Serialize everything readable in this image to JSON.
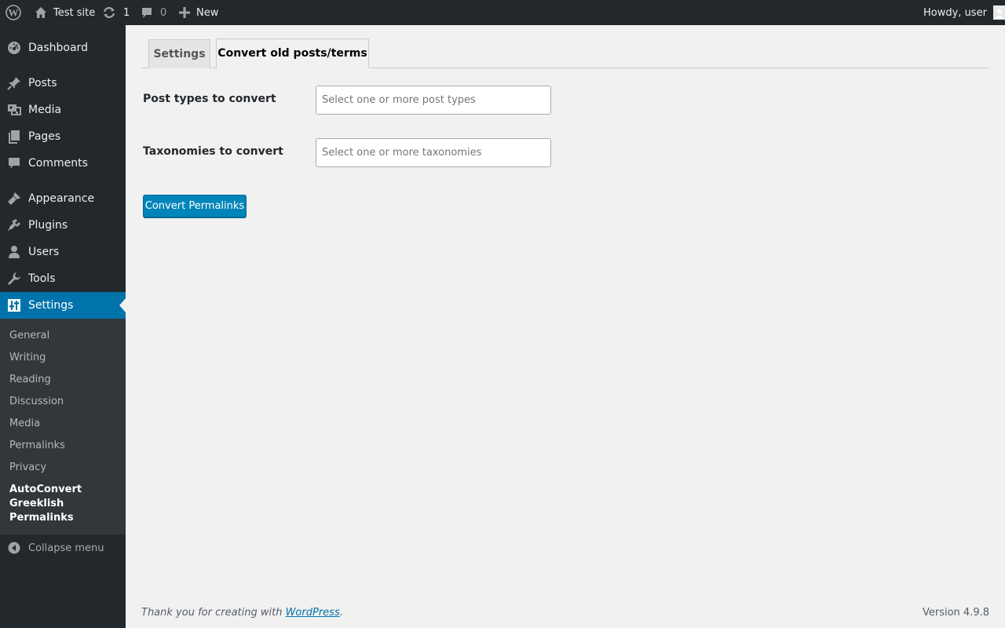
{
  "adminbar": {
    "site_name": "Test site",
    "updates_count": "1",
    "comments_count": "0",
    "new_label": "New",
    "greeting": "Howdy, user"
  },
  "menu": {
    "items": [
      {
        "label": "Dashboard",
        "icon": "dashboard-icon"
      },
      {
        "label": "Posts",
        "icon": "pin-icon"
      },
      {
        "label": "Media",
        "icon": "media-icon"
      },
      {
        "label": "Pages",
        "icon": "pages-icon"
      },
      {
        "label": "Comments",
        "icon": "comment-icon"
      },
      {
        "label": "Appearance",
        "icon": "brush-icon"
      },
      {
        "label": "Plugins",
        "icon": "plugin-icon"
      },
      {
        "label": "Users",
        "icon": "user-icon"
      },
      {
        "label": "Tools",
        "icon": "wrench-icon"
      },
      {
        "label": "Settings",
        "icon": "settings-icon"
      }
    ],
    "submenu": [
      "General",
      "Writing",
      "Reading",
      "Discussion",
      "Media",
      "Permalinks",
      "Privacy",
      "AutoConvert Greeklish Permalinks"
    ],
    "collapse_label": "Collapse menu"
  },
  "tabs": {
    "settings": "Settings",
    "convert": "Convert old posts/terms"
  },
  "form": {
    "post_types_label": "Post types to convert",
    "post_types_placeholder": "Select one or more post types",
    "taxonomies_label": "Taxonomies to convert",
    "taxonomies_placeholder": "Select one or more taxonomies",
    "submit_label": "Convert Permalinks"
  },
  "footer": {
    "thanks_prefix": "Thank you for creating with ",
    "thanks_link": "WordPress",
    "thanks_suffix": ".",
    "version": "Version 4.9.8"
  },
  "colors": {
    "adminbar_bg": "#23282d",
    "menu_current": "#0073aa",
    "submenu_bg": "#32373c",
    "primary_button": "#0085ba"
  }
}
